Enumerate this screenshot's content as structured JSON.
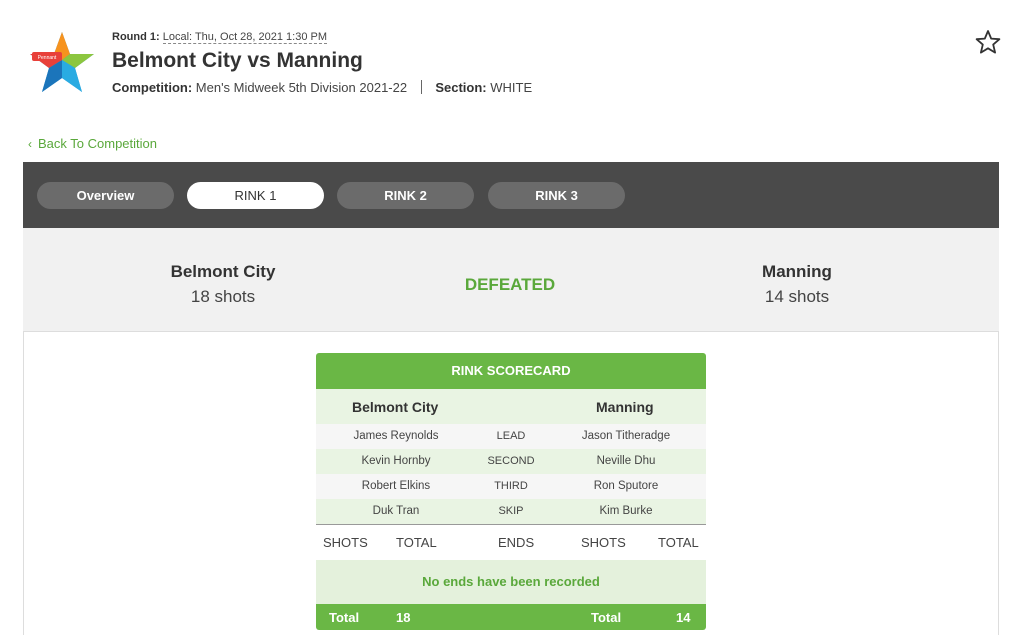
{
  "header": {
    "round_label": "Round 1:",
    "round_datetime": "Local: Thu, Oct 28, 2021 1:30 PM",
    "title": "Belmont City vs Manning",
    "competition_label": "Competition:",
    "competition_value": "Men's Midweek 5th Division 2021-22",
    "section_label": "Section:",
    "section_value": "WHITE"
  },
  "back_link": "Back To Competition",
  "tabs": [
    {
      "label": "Overview",
      "active": false
    },
    {
      "label": "RINK 1",
      "active": true
    },
    {
      "label": "RINK 2",
      "active": false
    },
    {
      "label": "RINK 3",
      "active": false
    }
  ],
  "result": {
    "home_team": "Belmont City",
    "home_shots": "18 shots",
    "status": "DEFEATED",
    "away_team": "Manning",
    "away_shots": "14 shots"
  },
  "scorecard": {
    "title": "RINK SCORECARD",
    "home_team": "Belmont City",
    "away_team": "Manning",
    "players": [
      {
        "home": "James Reynolds",
        "position": "LEAD",
        "away": "Jason Titheradge"
      },
      {
        "home": "Kevin Hornby",
        "position": "SECOND",
        "away": "Neville Dhu"
      },
      {
        "home": "Robert Elkins",
        "position": "THIRD",
        "away": "Ron Sputore"
      },
      {
        "home": "Duk Tran",
        "position": "SKIP",
        "away": "Kim Burke"
      }
    ],
    "columns": {
      "shots_home": "SHOTS",
      "total_home": "TOTAL",
      "ends": "ENDS",
      "shots_away": "SHOTS",
      "total_away": "TOTAL"
    },
    "no_ends_message": "No ends have been recorded",
    "total_row": {
      "home_label": "Total",
      "home_value": "18",
      "away_label": "Total",
      "away_value": "14"
    }
  },
  "colors": {
    "accent_green": "#6ab745",
    "text_green": "#5aa83b",
    "tab_bar": "#4a4a4a"
  },
  "icons": {
    "logo": "star-logo",
    "favorite": "star-outline-icon",
    "back": "chevron-left-icon"
  }
}
